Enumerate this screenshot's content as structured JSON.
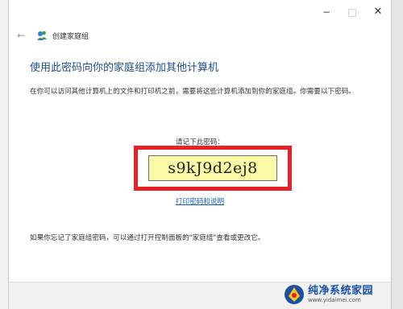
{
  "window": {
    "controls": {
      "minimize": "−",
      "maximize": "□",
      "close": "✕"
    },
    "nav": {
      "back_icon": "back-arrow-icon",
      "app_icon": "homegroup-icon",
      "title": "创建家庭组"
    }
  },
  "content": {
    "heading": "使用此密码向你的家庭组添加其他计算机",
    "description": "在你可以访问其他计算机上的文件和打印机之前，需要将这些计算机添加到你的家庭组。你需要以下密码。",
    "remember_label": "请记下此密码：",
    "password": "s9kJ9d2ej8",
    "print_link": "打印密码和说明",
    "footer_note": "如果你忘记了家庭组密码，可以通过打开控制面板的\"家庭组\"查看或更改它。"
  },
  "watermark": {
    "brand": "纯净系统家园",
    "url": "www.yidaimei.com"
  },
  "colors": {
    "heading": "#1e4e8c",
    "link": "#1b5fb8",
    "highlight_border": "#e8202a",
    "password_bg": "#fbf8a6"
  }
}
